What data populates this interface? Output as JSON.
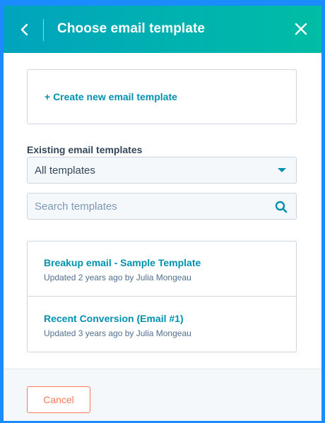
{
  "header": {
    "title": "Choose email template",
    "back_icon": "chevron-left-icon",
    "close_icon": "close-icon"
  },
  "create": {
    "label": "+ Create new email template"
  },
  "existing": {
    "label": "Existing email templates",
    "filter_selected": "All templates"
  },
  "search": {
    "placeholder": "Search templates",
    "value": "",
    "icon": "search-icon"
  },
  "templates": [
    {
      "name": "Breakup email - Sample Template",
      "meta": "Updated 2 years ago by Julia Mongeau"
    },
    {
      "name": "Recent Conversion (Email #1)",
      "meta": "Updated 3 years ago by Julia Mongeau"
    }
  ],
  "footer": {
    "cancel_label": "Cancel"
  },
  "colors": {
    "header_gradient_start": "#00a4bd",
    "header_gradient_end": "#00bda5",
    "link": "#0091ae",
    "cancel_accent": "#ff7a59",
    "frame": "#1a8cff"
  }
}
